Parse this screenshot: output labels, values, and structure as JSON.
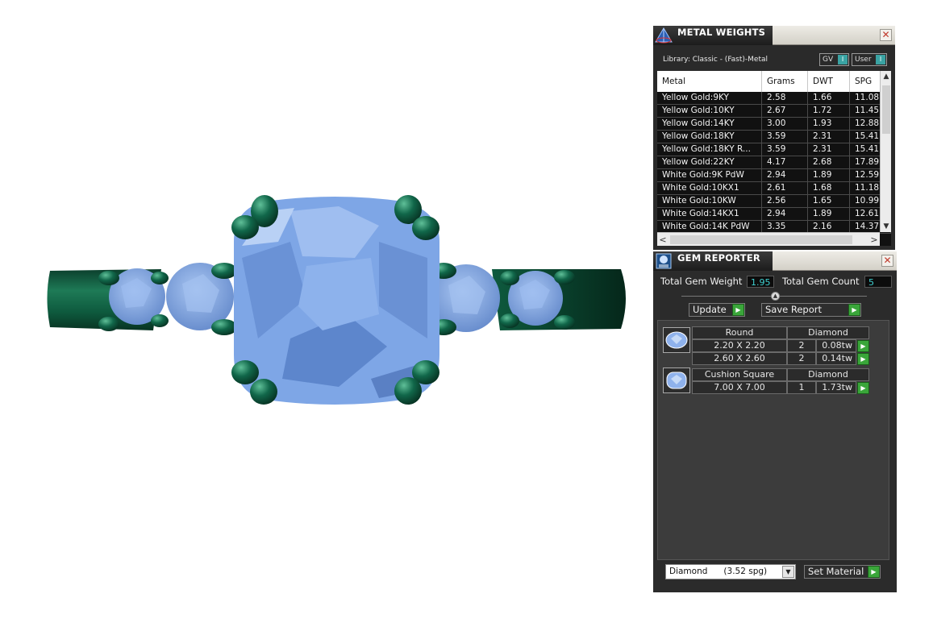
{
  "metal_weights": {
    "title": "METAL WEIGHTS",
    "close_glyph": "✕",
    "library_label": "Library: Classic - (Fast)-Metal",
    "toggles": [
      {
        "label": "GV",
        "state": "I"
      },
      {
        "label": "User",
        "state": "I"
      }
    ],
    "columns": [
      "Metal",
      "Grams",
      "DWT",
      "SPG"
    ],
    "rows": [
      [
        "Yellow Gold:9KY",
        "2.58",
        "1.66",
        "11.08"
      ],
      [
        "Yellow Gold:10KY",
        "2.67",
        "1.72",
        "11.45"
      ],
      [
        "Yellow Gold:14KY",
        "3.00",
        "1.93",
        "12.88"
      ],
      [
        "Yellow Gold:18KY",
        "3.59",
        "2.31",
        "15.41"
      ],
      [
        "Yellow Gold:18KY R...",
        "3.59",
        "2.31",
        "15.41"
      ],
      [
        "Yellow Gold:22KY",
        "4.17",
        "2.68",
        "17.89"
      ],
      [
        "White Gold:9K PdW",
        "2.94",
        "1.89",
        "12.59"
      ],
      [
        "White Gold:10KX1",
        "2.61",
        "1.68",
        "11.18"
      ],
      [
        "White Gold:10KW",
        "2.56",
        "1.65",
        "10.99"
      ],
      [
        "White Gold:14KX1",
        "2.94",
        "1.89",
        "12.61"
      ],
      [
        "White Gold:14K PdW",
        "3.35",
        "2.16",
        "14.37"
      ]
    ],
    "scroll_up": "▲",
    "scroll_down": "▼",
    "scroll_left": "<",
    "scroll_right": ">"
  },
  "gem_reporter": {
    "title": "GEM REPORTER",
    "close_glyph": "✕",
    "total_weight_label": "Total Gem Weight",
    "total_weight_value": "1.95",
    "total_count_label": "Total Gem Count",
    "total_count_value": "5",
    "collapse_glyph": "▲",
    "update_label": "Update",
    "save_report_label": "Save Report",
    "go_glyph": "▶",
    "groups": [
      {
        "shape": "Round",
        "material": "Diamond",
        "rows": [
          {
            "size": "2.20 X 2.20",
            "count": "2",
            "weight": "0.08tw"
          },
          {
            "size": "2.60 X 2.60",
            "count": "2",
            "weight": "0.14tw"
          }
        ]
      },
      {
        "shape": "Cushion Square",
        "material": "Diamond",
        "rows": [
          {
            "size": "7.00 X 7.00",
            "count": "1",
            "weight": "1.73tw"
          }
        ]
      }
    ],
    "material_select": "Diamond      (3.52 spg)",
    "dropdown_glyph": "▼",
    "set_material_label": "Set Material"
  },
  "colors": {
    "metal": "#0e5a3e",
    "gem": "#7ea6e6",
    "panel_bg": "#2a2a2a",
    "accent_cyan": "#3fd1d1",
    "go_green": "#3aa63a"
  }
}
